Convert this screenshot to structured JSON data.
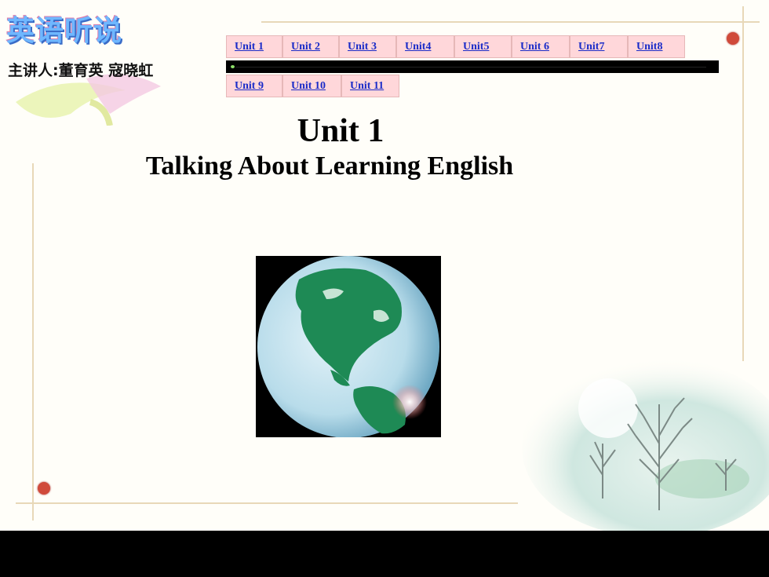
{
  "header": {
    "title": "英语听说",
    "presenter": "主讲人:董育英 寇晓虹"
  },
  "nav": {
    "row1": [
      "Unit 1",
      "Unit 2",
      "Unit 3",
      "Unit4",
      "Unit5",
      "Unit 6",
      "Unit7",
      "Unit8"
    ],
    "row2": [
      "Unit 9",
      "Unit 10",
      "Unit 11"
    ]
  },
  "content": {
    "heading": "Unit 1",
    "subtitle": "Talking About Learning English"
  },
  "colors": {
    "nav_bg": "#ffd7da",
    "link": "#1a2cc8",
    "accent_dot": "#d04a3a",
    "title": "#6fb7ff"
  },
  "icons": {
    "globe": "globe-image",
    "trees": "winter-trees-image"
  }
}
